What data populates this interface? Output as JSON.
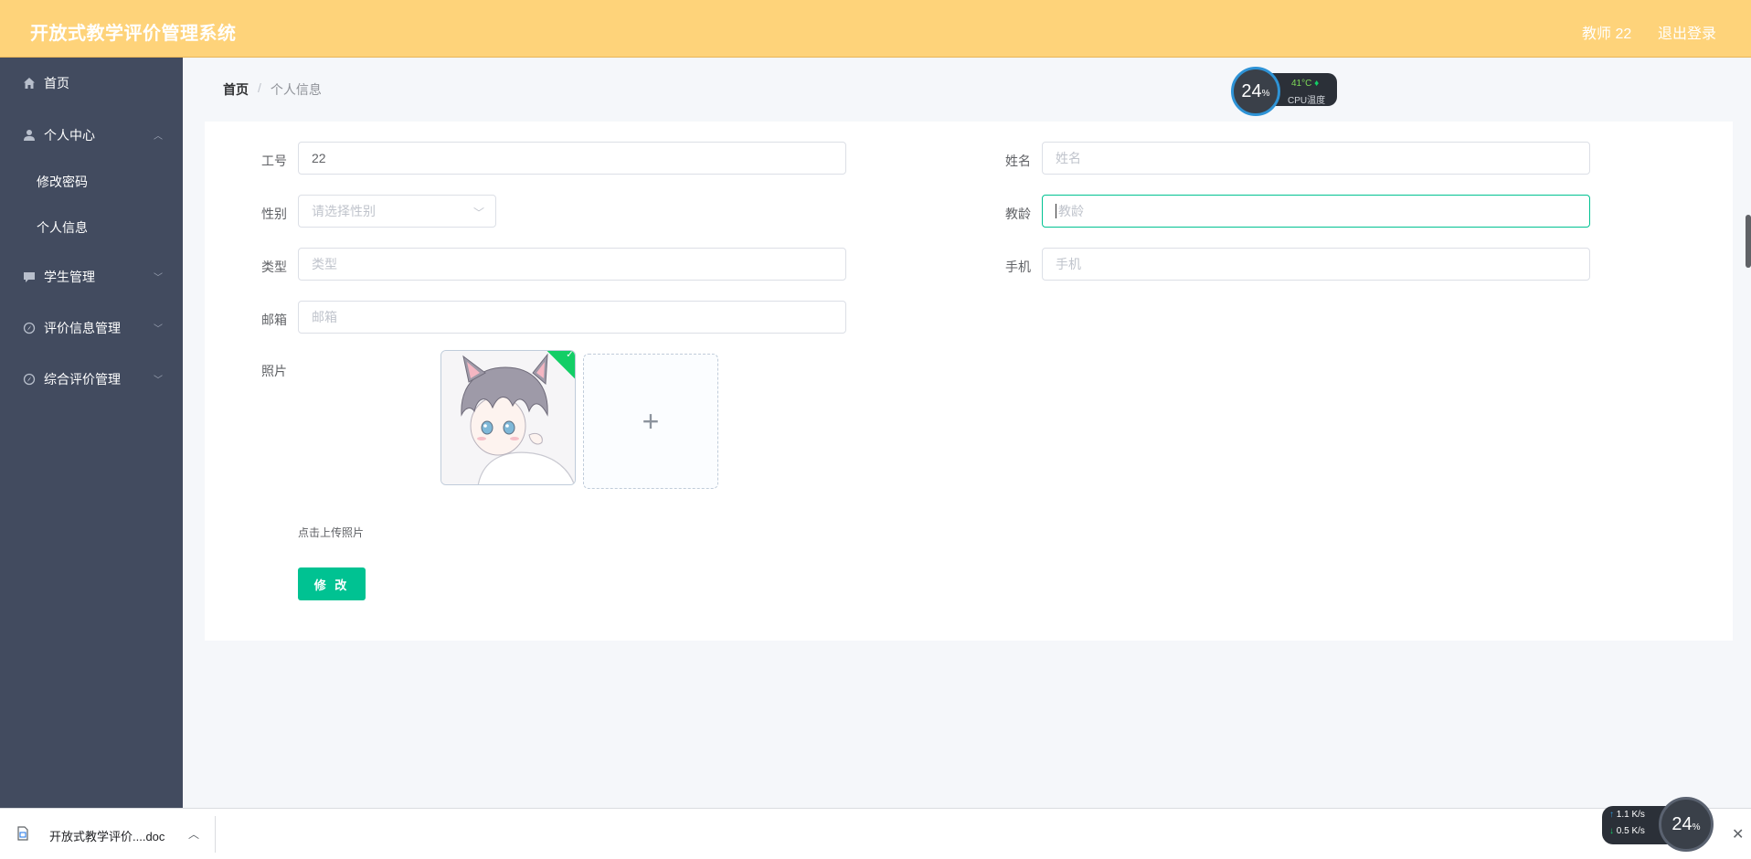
{
  "header": {
    "title": "开放式教学评价管理系统",
    "user": "教师 22",
    "logout": "退出登录"
  },
  "sidebar": {
    "items": [
      {
        "label": "首页",
        "icon": "home-icon"
      },
      {
        "label": "个人中心",
        "icon": "user-icon",
        "expanded": true,
        "children": [
          "修改密码",
          "个人信息"
        ]
      },
      {
        "label": "学生管理",
        "icon": "chat-icon"
      },
      {
        "label": "评价信息管理",
        "icon": "compass-icon"
      },
      {
        "label": "综合评价管理",
        "icon": "compass-icon"
      }
    ]
  },
  "breadcrumb": {
    "home": "首页",
    "separator": "/",
    "current": "个人信息"
  },
  "form": {
    "job_number": {
      "label": "工号",
      "value": "22"
    },
    "name": {
      "label": "姓名",
      "placeholder": "姓名"
    },
    "gender": {
      "label": "性别",
      "placeholder": "请选择性别"
    },
    "teaching_age": {
      "label": "教龄",
      "placeholder": "教龄"
    },
    "type": {
      "label": "类型",
      "placeholder": "类型"
    },
    "phone": {
      "label": "手机",
      "placeholder": "手机"
    },
    "email": {
      "label": "邮箱",
      "placeholder": "邮箱"
    },
    "photo": {
      "label": "照片",
      "tip": "点击上传照片",
      "add": "+"
    },
    "submit": "修 改"
  },
  "cpu_widget": {
    "percent": "24",
    "unit": "%",
    "temp": "41°C",
    "label": "CPU温度"
  },
  "download_bar": {
    "file": "开放式教学评价....doc",
    "close": "✕"
  },
  "net_widget": {
    "up": "1.1",
    "down": "0.5",
    "unit": "K/s",
    "percent": "24",
    "unit_percent": "%"
  },
  "colors": {
    "header_bg": "#fed37a",
    "sidebar_bg": "#424b5f",
    "accent": "#00c292"
  }
}
